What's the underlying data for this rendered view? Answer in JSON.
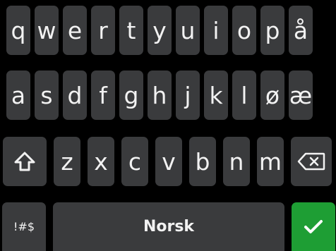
{
  "keyboard": {
    "language": "Norsk",
    "row1": [
      "q",
      "w",
      "e",
      "r",
      "t",
      "y",
      "u",
      "i",
      "o",
      "p",
      "å"
    ],
    "row2": [
      "a",
      "s",
      "d",
      "f",
      "g",
      "h",
      "j",
      "k",
      "l",
      "ø",
      "æ"
    ],
    "row3": [
      "z",
      "x",
      "c",
      "v",
      "b",
      "n",
      "m"
    ],
    "symbols_label": "!#$",
    "shift_icon": "shift-arrow-icon",
    "backspace_icon": "backspace-icon",
    "enter_icon": "checkmark-icon",
    "colors": {
      "background": "#000000",
      "key": "#3a3b3d",
      "key_text": "#f2f2f2",
      "enter": "#1e9e34"
    }
  }
}
